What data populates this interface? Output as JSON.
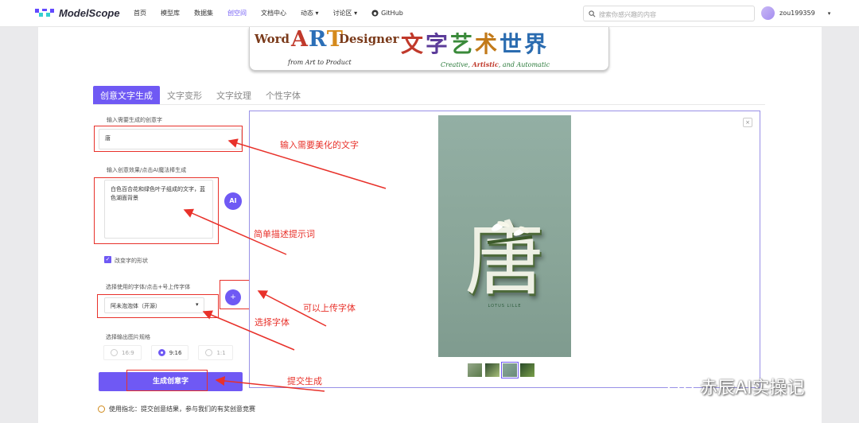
{
  "header": {
    "logo_text": "ModelScope",
    "nav": [
      "首页",
      "模型库",
      "数据集",
      "创空间",
      "文档中心",
      "动态 ▾",
      "讨论区 ▾",
      "GitHub"
    ],
    "active_nav": 3,
    "search_placeholder": "搜索你感兴趣的内容",
    "username": "zou199359",
    "user_caret": "▾"
  },
  "banner": {
    "word": "Word",
    "art_a": "A",
    "art_r": "R",
    "art_t": "T",
    "designer": "Designer",
    "subtitle": "from Art to Product",
    "cn_chars": [
      "文",
      "字",
      "艺",
      "术",
      "世",
      "界"
    ],
    "eng_prefix": "Creative, ",
    "eng_mid": "Artistic",
    "eng_suffix": ", and Automatic"
  },
  "tabs": [
    "创意文字生成",
    "文字变形",
    "文字纹理",
    "个性字体"
  ],
  "form": {
    "text_label": "输入需要生成的创意字",
    "text_value": "唐",
    "prompt_label": "输入创意效果/点击AI魔法棒生成",
    "prompt_value": "白色百合花和绿色叶子组成的文字，蓝色湖面背景",
    "ai_button": "AI",
    "shape_checkbox": "改变字的形状",
    "font_label": "选择使用的字体/点击+号上传字体",
    "font_value": "阿未泡泡体（开源）",
    "font_caret": "▾",
    "plus_button": "+",
    "size_label": "选择输出图片规格",
    "sizes": [
      "16:9",
      "9:16",
      "1:1"
    ],
    "selected_size": 1,
    "generate_button": "生成创意字"
  },
  "preview": {
    "close": "×",
    "char": "唐",
    "caption": "LOTUS LILLE",
    "thumbnails": 4,
    "selected_thumb": 2
  },
  "annotations": {
    "a1": "输入需要美化的文字",
    "a2": "简单描述提示词",
    "a3": "可以上传字体",
    "a4": "选择字体",
    "a5": "提交生成"
  },
  "footer": "使用指北：提交创意结果，参与我们的有奖创意竞赛",
  "watermark": "赤辰AI实操记",
  "colors": {
    "accent": "#6f59f4",
    "annotation": "#e8312a"
  }
}
